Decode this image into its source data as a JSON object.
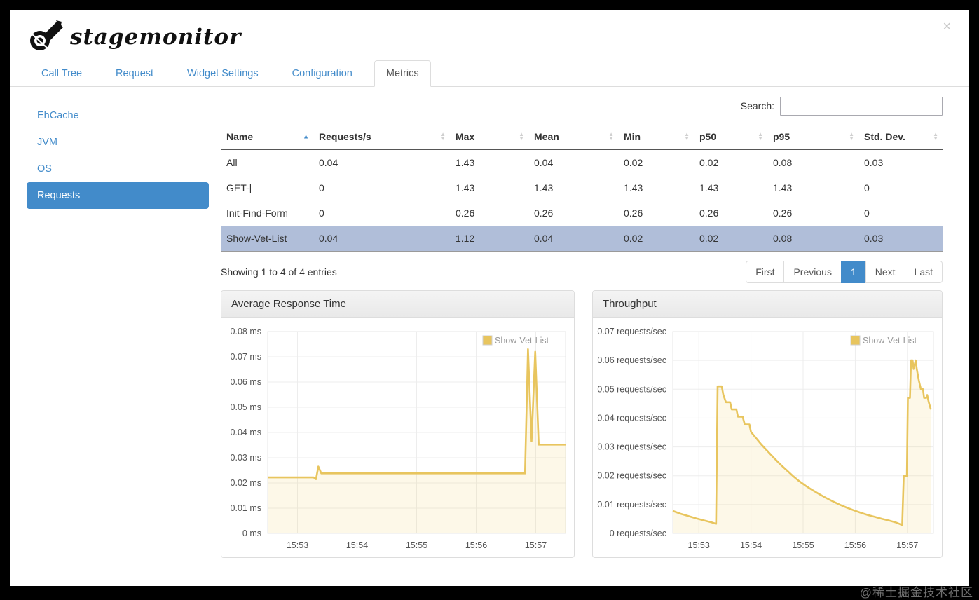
{
  "window": {
    "close_label": "×",
    "watermark": "@稀土掘金技术社区"
  },
  "logo": {
    "text": "stagemonitor"
  },
  "tabs": [
    {
      "label": "Call Tree",
      "active": false
    },
    {
      "label": "Request",
      "active": false
    },
    {
      "label": "Widget Settings",
      "active": false
    },
    {
      "label": "Configuration",
      "active": false
    },
    {
      "label": "Metrics",
      "active": true
    }
  ],
  "sidebar": {
    "items": [
      {
        "label": "EhCache",
        "active": false
      },
      {
        "label": "JVM",
        "active": false
      },
      {
        "label": "OS",
        "active": false
      },
      {
        "label": "Requests",
        "active": true
      }
    ]
  },
  "search": {
    "label": "Search:",
    "value": ""
  },
  "table": {
    "columns": [
      {
        "label": "Name",
        "sorted": "asc"
      },
      {
        "label": "Requests/s"
      },
      {
        "label": "Max"
      },
      {
        "label": "Mean"
      },
      {
        "label": "Min"
      },
      {
        "label": "p50"
      },
      {
        "label": "p95"
      },
      {
        "label": "Std. Dev."
      }
    ],
    "rows": [
      {
        "name": "All",
        "values": [
          "0.04",
          "1.43",
          "0.04",
          "0.02",
          "0.02",
          "0.08",
          "0.03"
        ],
        "selected": false
      },
      {
        "name": "GET-|",
        "values": [
          "0",
          "1.43",
          "1.43",
          "1.43",
          "1.43",
          "1.43",
          "0"
        ],
        "selected": false
      },
      {
        "name": "Init-Find-Form",
        "values": [
          "0",
          "0.26",
          "0.26",
          "0.26",
          "0.26",
          "0.26",
          "0"
        ],
        "selected": false
      },
      {
        "name": "Show-Vet-List",
        "values": [
          "0.04",
          "1.12",
          "0.04",
          "0.02",
          "0.02",
          "0.08",
          "0.03"
        ],
        "selected": true
      }
    ],
    "info": "Showing 1 to 4 of 4 entries",
    "pagination": {
      "items": [
        "First",
        "Previous",
        "1",
        "Next",
        "Last"
      ],
      "active": "1"
    }
  },
  "chart_data": [
    {
      "type": "area",
      "title": "Average Response Time",
      "legend": [
        {
          "name": "Show-Vet-List",
          "color": "#e8c55e"
        }
      ],
      "legend_position": "ne",
      "grid": true,
      "xlim": [
        52.5,
        57.5
      ],
      "ylim": [
        0,
        0.08
      ],
      "x_ticks": [
        {
          "v": 53,
          "label": "15:53"
        },
        {
          "v": 54,
          "label": "15:54"
        },
        {
          "v": 55,
          "label": "15:55"
        },
        {
          "v": 56,
          "label": "15:56"
        },
        {
          "v": 57,
          "label": "15:57"
        }
      ],
      "y_ticks": [
        {
          "v": 0,
          "label": "0 ms"
        },
        {
          "v": 0.01,
          "label": "0.01 ms"
        },
        {
          "v": 0.02,
          "label": "0.02 ms"
        },
        {
          "v": 0.03,
          "label": "0.03 ms"
        },
        {
          "v": 0.04,
          "label": "0.04 ms"
        },
        {
          "v": 0.05,
          "label": "0.05 ms"
        },
        {
          "v": 0.06,
          "label": "0.06 ms"
        },
        {
          "v": 0.07,
          "label": "0.07 ms"
        },
        {
          "v": 0.08,
          "label": "0.08 ms"
        }
      ],
      "series": [
        {
          "name": "Show-Vet-List",
          "color": "#e8c55e",
          "fill": "rgba(237,194,64,0.12)",
          "points": [
            [
              52.5,
              0.0222
            ],
            [
              52.9,
              0.0222
            ],
            [
              53.27,
              0.0222
            ],
            [
              53.31,
              0.0215
            ],
            [
              53.35,
              0.0265
            ],
            [
              53.4,
              0.0238
            ],
            [
              54.0,
              0.0238
            ],
            [
              55.0,
              0.0238
            ],
            [
              56.0,
              0.0238
            ],
            [
              56.82,
              0.0238
            ],
            [
              56.87,
              0.073
            ],
            [
              56.93,
              0.0365
            ],
            [
              56.99,
              0.072
            ],
            [
              57.05,
              0.0352
            ],
            [
              57.2,
              0.0352
            ],
            [
              57.5,
              0.0352
            ]
          ]
        }
      ]
    },
    {
      "type": "area",
      "title": "Throughput",
      "legend": [
        {
          "name": "Show-Vet-List",
          "color": "#e8c55e"
        }
      ],
      "legend_position": "ne",
      "grid": true,
      "xlim": [
        52.5,
        57.5
      ],
      "ylim": [
        0,
        0.07
      ],
      "x_ticks": [
        {
          "v": 53,
          "label": "15:53"
        },
        {
          "v": 54,
          "label": "15:54"
        },
        {
          "v": 55,
          "label": "15:55"
        },
        {
          "v": 56,
          "label": "15:56"
        },
        {
          "v": 57,
          "label": "15:57"
        }
      ],
      "y_ticks": [
        {
          "v": 0,
          "label": "0 requests/sec"
        },
        {
          "v": 0.01,
          "label": "0.01 requests/sec"
        },
        {
          "v": 0.02,
          "label": "0.02 requests/sec"
        },
        {
          "v": 0.03,
          "label": "0.03 requests/sec"
        },
        {
          "v": 0.04,
          "label": "0.04 requests/sec"
        },
        {
          "v": 0.05,
          "label": "0.05 requests/sec"
        },
        {
          "v": 0.06,
          "label": "0.06 requests/sec"
        },
        {
          "v": 0.07,
          "label": "0.07 requests/sec"
        }
      ],
      "series": [
        {
          "name": "Show-Vet-List",
          "color": "#e8c55e",
          "fill": "rgba(237,194,64,0.12)",
          "points": [
            [
              52.5,
              0.0078
            ],
            [
              52.65,
              0.0068
            ],
            [
              52.8,
              0.006
            ],
            [
              52.95,
              0.0052
            ],
            [
              53.1,
              0.0045
            ],
            [
              53.25,
              0.0038
            ],
            [
              53.33,
              0.0033
            ],
            [
              53.36,
              0.051
            ],
            [
              53.44,
              0.051
            ],
            [
              53.47,
              0.048
            ],
            [
              53.52,
              0.0455
            ],
            [
              53.6,
              0.0455
            ],
            [
              53.63,
              0.043
            ],
            [
              53.72,
              0.043
            ],
            [
              53.75,
              0.0405
            ],
            [
              53.84,
              0.0405
            ],
            [
              53.88,
              0.0378
            ],
            [
              53.97,
              0.0378
            ],
            [
              54.0,
              0.0352
            ],
            [
              54.1,
              0.033
            ],
            [
              54.2,
              0.0308
            ],
            [
              54.32,
              0.0285
            ],
            [
              54.44,
              0.0262
            ],
            [
              54.56,
              0.024
            ],
            [
              54.68,
              0.022
            ],
            [
              54.8,
              0.02
            ],
            [
              54.92,
              0.0182
            ],
            [
              55.05,
              0.0165
            ],
            [
              55.18,
              0.015
            ],
            [
              55.31,
              0.0136
            ],
            [
              55.44,
              0.0123
            ],
            [
              55.57,
              0.0111
            ],
            [
              55.7,
              0.01
            ],
            [
              55.83,
              0.009
            ],
            [
              55.96,
              0.0081
            ],
            [
              56.1,
              0.0072
            ],
            [
              56.24,
              0.0064
            ],
            [
              56.38,
              0.0057
            ],
            [
              56.52,
              0.005
            ],
            [
              56.66,
              0.0044
            ],
            [
              56.78,
              0.0038
            ],
            [
              56.86,
              0.0032
            ],
            [
              56.9,
              0.0028
            ],
            [
              56.93,
              0.02
            ],
            [
              56.99,
              0.02
            ],
            [
              57.01,
              0.047
            ],
            [
              57.05,
              0.047
            ],
            [
              57.07,
              0.06
            ],
            [
              57.1,
              0.06
            ],
            [
              57.12,
              0.057
            ],
            [
              57.16,
              0.06
            ],
            [
              57.18,
              0.057
            ],
            [
              57.22,
              0.053
            ],
            [
              57.26,
              0.05
            ],
            [
              57.3,
              0.05
            ],
            [
              57.32,
              0.047
            ],
            [
              57.36,
              0.047
            ],
            [
              57.38,
              0.048
            ],
            [
              57.41,
              0.0455
            ],
            [
              57.45,
              0.043
            ]
          ]
        }
      ]
    }
  ]
}
